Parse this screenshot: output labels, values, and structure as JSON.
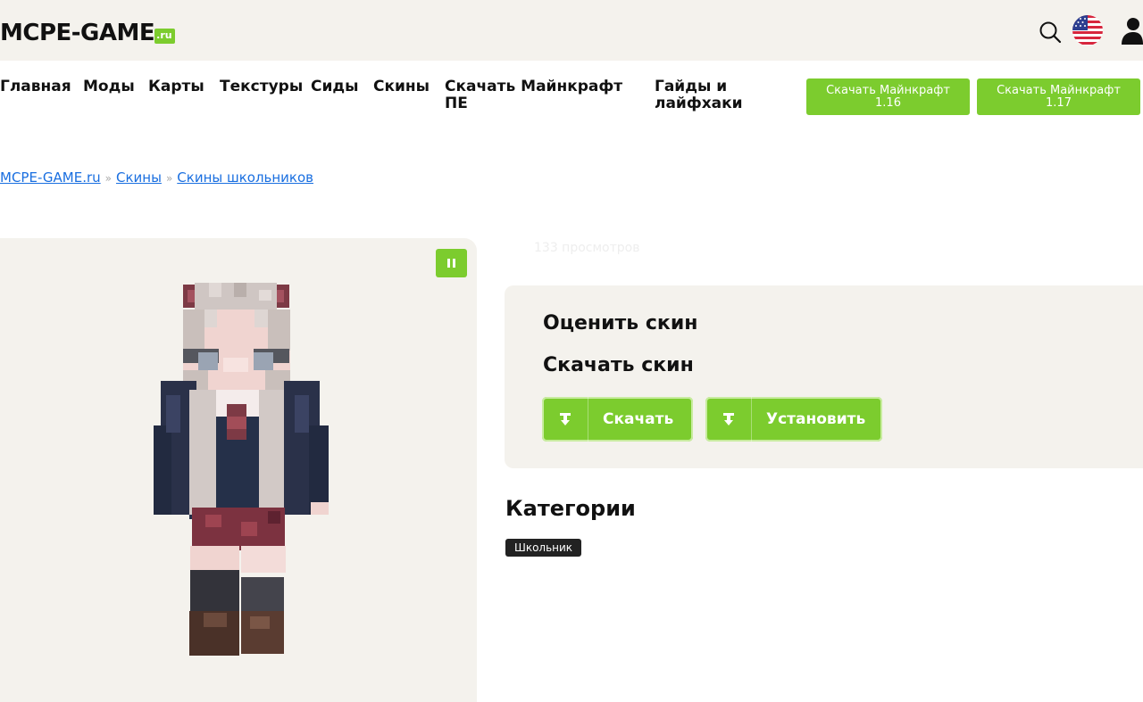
{
  "header": {
    "logo_main": "MCPE-GAME",
    "logo_suffix": ".ru",
    "icons": [
      "search-icon",
      "us-flag-icon",
      "user-icon"
    ]
  },
  "nav": {
    "items": [
      {
        "label": "Главная"
      },
      {
        "label": "Моды"
      },
      {
        "label": "Карты"
      },
      {
        "label": "Текстуры"
      },
      {
        "label": "Сиды"
      },
      {
        "label": "Скины"
      },
      {
        "label": "Скачать Майнкрафт",
        "label2": "ПЕ"
      },
      {
        "label": "Гайды и",
        "label2": "лайфхаки"
      }
    ],
    "buttons": [
      {
        "line1": "Скачать Майнкрафт",
        "line2": "1.16"
      },
      {
        "line1": "Скачать Майнкрафт",
        "line2": "1.17"
      }
    ]
  },
  "breadcrumb": {
    "items": [
      "MCPE-GAME.ru",
      "Скины",
      "Скины школьников"
    ],
    "separator": "»"
  },
  "skin": {
    "views_text": "133 просмотров"
  },
  "rate_card": {
    "rate_title": "Оценить скин",
    "download_title": "Скачать скин",
    "download_label": "Скачать",
    "install_label": "Установить"
  },
  "categories": {
    "title": "Категории",
    "tags": [
      "Школьник"
    ]
  },
  "colors": {
    "accent_green": "#7ccc2e",
    "panel_bg": "#f4f2ed",
    "link_blue": "#1a6fe0",
    "tag_bg": "#222222"
  }
}
